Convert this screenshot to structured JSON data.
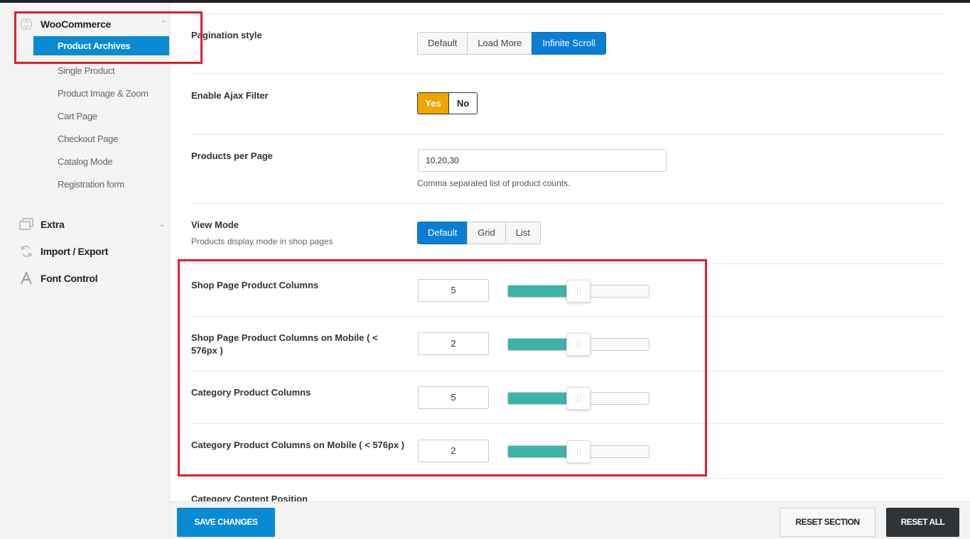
{
  "sidebar": {
    "woocommerce": {
      "label": "WooCommerce",
      "icon": "woocommerce-icon"
    },
    "active_item": "Product Archives",
    "sub_items": [
      "Single Product",
      "Product Image & Zoom",
      "Cart Page",
      "Checkout Page",
      "Catalog Mode",
      "Registration form"
    ],
    "extra": {
      "label": "Extra",
      "icon": "layers-icon"
    },
    "import_export": {
      "label": "Import / Export",
      "icon": "refresh-icon"
    },
    "font_control": {
      "label": "Font Control",
      "icon": "font-icon"
    }
  },
  "fields": {
    "pagination": {
      "label": "Pagination style",
      "options": [
        "Default",
        "Load More",
        "Infinite Scroll"
      ],
      "selected": "Infinite Scroll"
    },
    "ajax_filter": {
      "label": "Enable Ajax Filter",
      "yes": "Yes",
      "no": "No",
      "selected": "Yes"
    },
    "products_per_page": {
      "label": "Products per Page",
      "value": "10,20,30",
      "hint": "Comma separated list of product counts."
    },
    "view_mode": {
      "label": "View Mode",
      "desc": "Products display mode in shop pages",
      "options": [
        "Default",
        "Grid",
        "List"
      ],
      "selected": "Default"
    },
    "shop_columns": {
      "label": "Shop Page Product Columns",
      "value": "5",
      "fraction": 0.5
    },
    "shop_columns_mobile": {
      "label": "Shop Page Product Columns on Mobile ( < 576px )",
      "value": "2",
      "fraction": 0.5
    },
    "category_columns": {
      "label": "Category Product Columns",
      "value": "5",
      "fraction": 0.5
    },
    "category_columns_mobile": {
      "label": "Category Product Columns on Mobile ( < 576px )",
      "value": "2",
      "fraction": 0.5
    },
    "category_content_position": {
      "label": "Category Content Position"
    }
  },
  "footer": {
    "save": "SAVE CHANGES",
    "reset_section": "RESET SECTION",
    "reset_all": "RESET ALL"
  },
  "colors": {
    "accent": "#0a8ad2",
    "yes_active": "#f0a400",
    "slider_fill": "#3cb3a8",
    "highlight_box": "#e0202a"
  }
}
